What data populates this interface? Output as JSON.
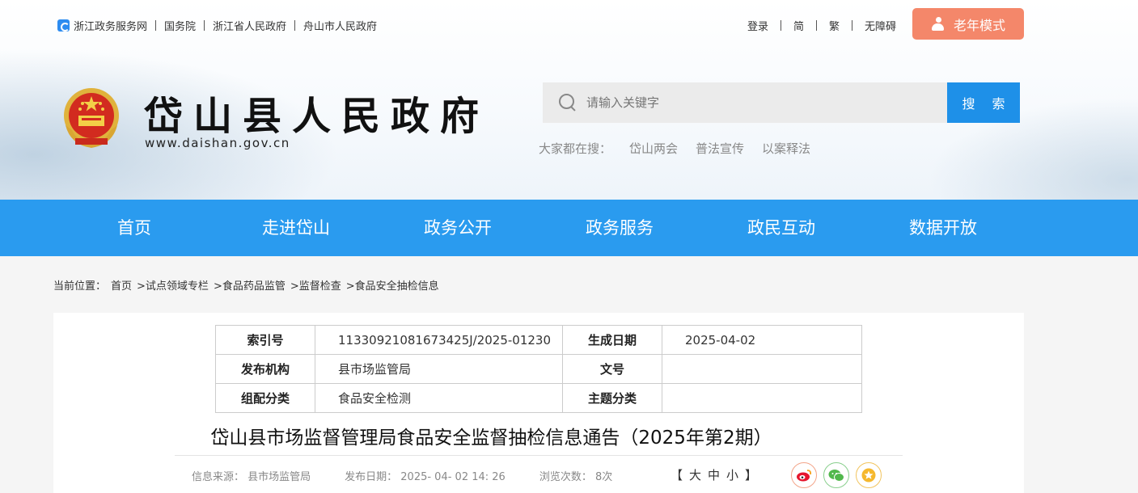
{
  "top_links": [
    "浙江政务服务网",
    "国务院",
    "浙江省人民政府",
    "舟山市人民政府"
  ],
  "user_links": [
    "登录",
    "简",
    "繁",
    "无障碍"
  ],
  "elder_mode": "老年模式",
  "site": {
    "title": "岱山县人民政府",
    "url": "www.daishan.gov.cn"
  },
  "search": {
    "placeholder": "请输入关键字",
    "button": "搜 索"
  },
  "hot": {
    "label": "大家都在搜：",
    "items": [
      "岱山两会",
      "普法宣传",
      "以案释法"
    ]
  },
  "nav": [
    "首页",
    "走进岱山",
    "政务公开",
    "政务服务",
    "政民互动",
    "数据开放"
  ],
  "breadcrumb": [
    "当前位置：",
    "首页",
    ">试点领域专栏",
    ">食品药品监管",
    ">监督检查",
    ">食品安全抽检信息"
  ],
  "meta": {
    "index_label": "索引号",
    "index_value": "11330921081673425J/2025-01230",
    "date_label": "生成日期",
    "date_value": "2025-04-02",
    "org_label": "发布机构",
    "org_value": "县市场监管局",
    "docno_label": "文号",
    "docno_value": "",
    "cat_label": "组配分类",
    "cat_value": "食品安全检测",
    "topic_label": "主题分类",
    "topic_value": ""
  },
  "doc": {
    "title": "岱山县市场监督管理局食品安全监督抽检信息通告（2025年第2期）",
    "source": "信息来源： 县市场监管局",
    "published": "发布日期： 2025- 04- 02 14: 26",
    "views": "浏览次数： 8次",
    "font_size": "【大中小】"
  },
  "icons": {
    "weibo": "weibo-icon",
    "wechat": "wechat-icon",
    "favorite": "star-icon"
  },
  "colors": {
    "nav": "#2a9bef",
    "search_button": "#1e90e8",
    "elder_button": "#f4876a"
  }
}
